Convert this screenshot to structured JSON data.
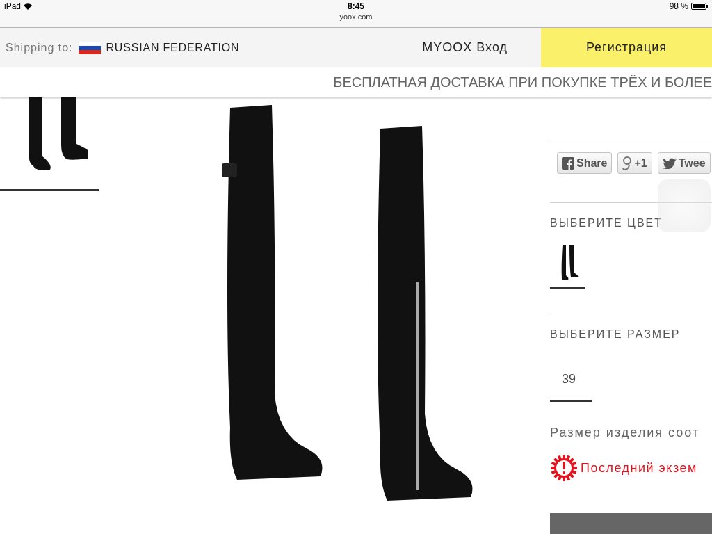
{
  "status_bar": {
    "device": "iPad",
    "time": "8:45",
    "battery": "98 %"
  },
  "address_bar": {
    "url": "yoox.com"
  },
  "header": {
    "shipping_label": "Shipping to:",
    "country": "RUSSIAN FEDERATION",
    "login": "MYOOX Вход",
    "register": "Регистрация"
  },
  "promo_banner": "БЕСПЛАТНАЯ ДОСТАВКА ПРИ ПОКУПКЕ ТРЁХ И БОЛЕЕ",
  "thumbnails": [
    {
      "selected": true
    }
  ],
  "share_buttons": [
    {
      "kind": "facebook",
      "label": "Share"
    },
    {
      "kind": "google",
      "label": "+1"
    },
    {
      "kind": "twitter",
      "label": "Twee"
    }
  ],
  "color_section": {
    "title": "ВЫБЕРИТЕ ЦВЕТ",
    "options": [
      {
        "selected": true
      }
    ]
  },
  "size_section": {
    "title": "ВЫБЕРИТЕ РАЗМЕР",
    "options": [
      {
        "label": "39",
        "selected": true
      }
    ]
  },
  "size_note": "Размер изделия соот",
  "stock_warning": "Последний экзем"
}
